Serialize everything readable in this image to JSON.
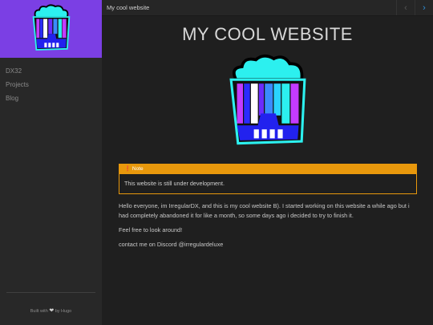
{
  "sidebar": {
    "nav": [
      {
        "label": "DX32"
      },
      {
        "label": "Projects"
      },
      {
        "label": "Blog"
      }
    ],
    "footer": {
      "prefix": "Built with",
      "suffix": "by Hugo"
    }
  },
  "topbar": {
    "title": "My cool website"
  },
  "page": {
    "title": "MY COOL WEBSITE",
    "note": {
      "label": "Note",
      "text": "This website is still under development."
    },
    "paragraphs": [
      "Hello everyone, im IrregularDX, and this is my cool website B). I started working on this website a while ago but i had completely abandoned it for like a month, so some days ago i decided to try to finish it.",
      "Feel free to look around!",
      "contact me on Discord @irregulardeluxe"
    ]
  },
  "colors": {
    "sidebar_accent": "#7b3fe4",
    "note": "#e8980c",
    "link": "#2f8fd8"
  },
  "icons": {
    "prev": "chevron-left-icon",
    "next": "chevron-right-icon",
    "note": "info-icon",
    "heart": "heart-icon"
  }
}
